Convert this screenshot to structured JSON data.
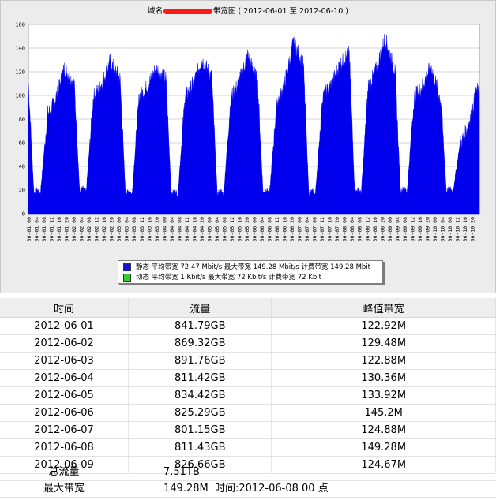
{
  "title": {
    "prefix": "域名",
    "suffix": "带宽图 ( 2012-06-01 至 2012-06-10 )"
  },
  "chart_data": {
    "type": "area",
    "ylim": [
      0,
      160
    ],
    "yticks": [
      0,
      20,
      40,
      60,
      80,
      100,
      120,
      140,
      160
    ],
    "grid": true,
    "color": "#0000ee",
    "x_tick_labels": [
      "06-01 00",
      "06-01 04",
      "06-01 08",
      "06-01 12",
      "06-01 16",
      "06-01 20",
      "06-02 00",
      "06-02 04",
      "06-02 08",
      "06-02 12",
      "06-02 16",
      "06-02 20",
      "06-03 00",
      "06-03 04",
      "06-03 08",
      "06-03 12",
      "06-03 16",
      "06-03 20",
      "06-04 00",
      "06-04 04",
      "06-04 08",
      "06-04 12",
      "06-04 16",
      "06-04 20",
      "06-05 00",
      "06-05 04",
      "06-05 08",
      "06-05 12",
      "06-05 16",
      "06-05 20",
      "06-06 00",
      "06-06 04",
      "06-06 08",
      "06-06 12",
      "06-06 16",
      "06-06 20",
      "06-07 00",
      "06-07 04",
      "06-07 08",
      "06-07 12",
      "06-07 16",
      "06-07 20",
      "06-08 00",
      "06-08 04",
      "06-08 08",
      "06-08 12",
      "06-08 16",
      "06-08 20",
      "06-09 00",
      "06-09 04",
      "06-09 08",
      "06-09 12",
      "06-09 16",
      "06-09 20",
      "06-10 00",
      "06-10 04",
      "06-10 08",
      "06-10 12",
      "06-10 16",
      "06-10 20"
    ],
    "daily_profile": [
      {
        "day": "06-01",
        "start": 110,
        "min": 17,
        "mid": 85,
        "peak": 123
      },
      {
        "day": "06-02",
        "start": 110,
        "min": 18,
        "mid": 100,
        "peak": 129
      },
      {
        "day": "06-03",
        "start": 114,
        "min": 16,
        "mid": 100,
        "peak": 123
      },
      {
        "day": "06-04",
        "start": 114,
        "min": 16,
        "mid": 100,
        "peak": 130
      },
      {
        "day": "06-05",
        "start": 116,
        "min": 16,
        "mid": 100,
        "peak": 134
      },
      {
        "day": "06-06",
        "start": 112,
        "min": 17,
        "mid": 95,
        "peak": 145
      },
      {
        "day": "06-07",
        "start": 126,
        "min": 16,
        "mid": 100,
        "peak": 125
      },
      {
        "day": "06-08",
        "start": 136,
        "min": 17,
        "mid": 110,
        "peak": 149
      },
      {
        "day": "06-09",
        "start": 120,
        "min": 18,
        "mid": 100,
        "peak": 125
      },
      {
        "day": "06-10",
        "start": 95,
        "min": 18,
        "mid": 60,
        "peak": 105
      }
    ],
    "legend": [
      {
        "color": "#1515cc",
        "text": "静态 平均带宽 72.47 Mbit/s 最大带宽 149.28 Mbit/s 计费带宽 149.28 Mbit"
      },
      {
        "color": "#33cc33",
        "text": "动态 平均带宽 1 Kbit/s 最大带宽 72 Kbit/s 计费带宽 72 Kbit"
      }
    ]
  },
  "table": {
    "headers": [
      "时间",
      "流量",
      "峰值带宽"
    ],
    "rows": [
      [
        "2012-06-01",
        "841.79GB",
        "122.92M"
      ],
      [
        "2012-06-02",
        "869.32GB",
        "129.48M"
      ],
      [
        "2012-06-03",
        "891.76GB",
        "122.88M"
      ],
      [
        "2012-06-04",
        "811.42GB",
        "130.36M"
      ],
      [
        "2012-06-05",
        "834.42GB",
        "133.92M"
      ],
      [
        "2012-06-06",
        "825.29GB",
        "145.2M"
      ],
      [
        "2012-06-07",
        "801.15GB",
        "124.88M"
      ],
      [
        "2012-06-08",
        "811.43GB",
        "149.28M"
      ],
      [
        "2012-06-09",
        "826.66GB",
        "124.67M"
      ]
    ]
  },
  "summary": {
    "total_label": "总流量",
    "total_value": "7.51TB",
    "max_label": "最大带宽",
    "max_value": "149.28M  时间:2012-06-08 00 点"
  }
}
